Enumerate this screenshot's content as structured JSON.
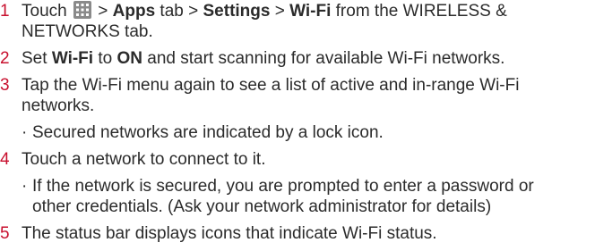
{
  "accent_color": "#c8102e",
  "steps": [
    {
      "number": "1",
      "pre": "Touch ",
      "icon": "apps-grid-icon",
      "mid1": " > ",
      "b1": "Apps",
      "mid2": " tab > ",
      "b2": "Settings",
      "mid3": " > ",
      "b3": "Wi-Fi",
      "post": " from the WIRELESS &",
      "cont": "NETWORKS tab."
    },
    {
      "number": "2",
      "pre": "Set ",
      "b1": "Wi-Fi",
      "mid1": " to ",
      "b2": "ON",
      "post": " and start scanning for available Wi-Fi networks."
    },
    {
      "number": "3",
      "text": "Tap the Wi-Fi menu again to see a list of active and in-range Wi-Fi",
      "cont": "networks.",
      "bullet": "Secured networks are indicated by a lock icon."
    },
    {
      "number": "4",
      "text": "Touch a network to connect to it.",
      "bullet": "If the network is secured, you are prompted to enter a password or",
      "bullet_cont": "other credentials. (Ask your network administrator for details)"
    },
    {
      "number": "5",
      "text": "The status bar displays icons that indicate Wi-Fi status."
    }
  ],
  "bullet_char": "·"
}
